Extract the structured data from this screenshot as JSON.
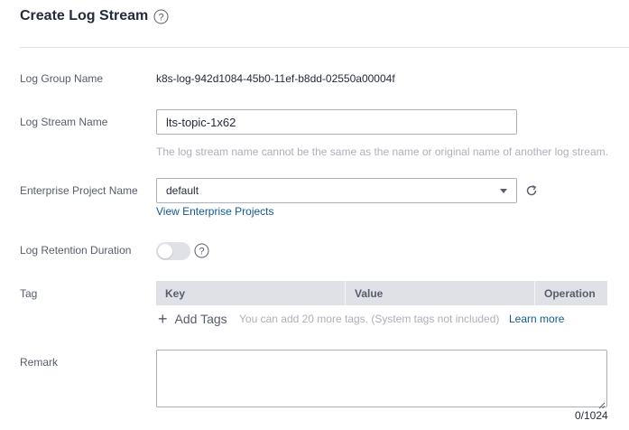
{
  "header": {
    "title": "Create Log Stream"
  },
  "form": {
    "log_group": {
      "label": "Log Group Name",
      "value": "k8s-log-942d1084-45b0-11ef-b8dd-02550a00004f"
    },
    "log_stream": {
      "label": "Log Stream Name",
      "value": "lts-topic-1x62",
      "hint": "The log stream name cannot be the same as the name or original name of another log stream."
    },
    "enterprise_project": {
      "label": "Enterprise Project Name",
      "selected": "default",
      "link": "View Enterprise Projects"
    },
    "retention": {
      "label": "Log Retention Duration",
      "enabled": false
    },
    "tag": {
      "label": "Tag",
      "columns": [
        "Key",
        "Value",
        "Operation"
      ],
      "add_label": "Add Tags",
      "note": "You can add 20 more tags. (System tags not included)",
      "learn_more": "Learn more"
    },
    "remark": {
      "label": "Remark",
      "value": "",
      "counter": "0/1024"
    }
  },
  "colors": {
    "link": "#0d5a94",
    "label": "#575d6c",
    "border": "#adb0b8",
    "table_header": "#dfe1e6"
  },
  "icons": {
    "help": "question-circle-icon",
    "refresh": "refresh-icon",
    "caret": "caret-down-icon",
    "plus": "plus-icon"
  }
}
